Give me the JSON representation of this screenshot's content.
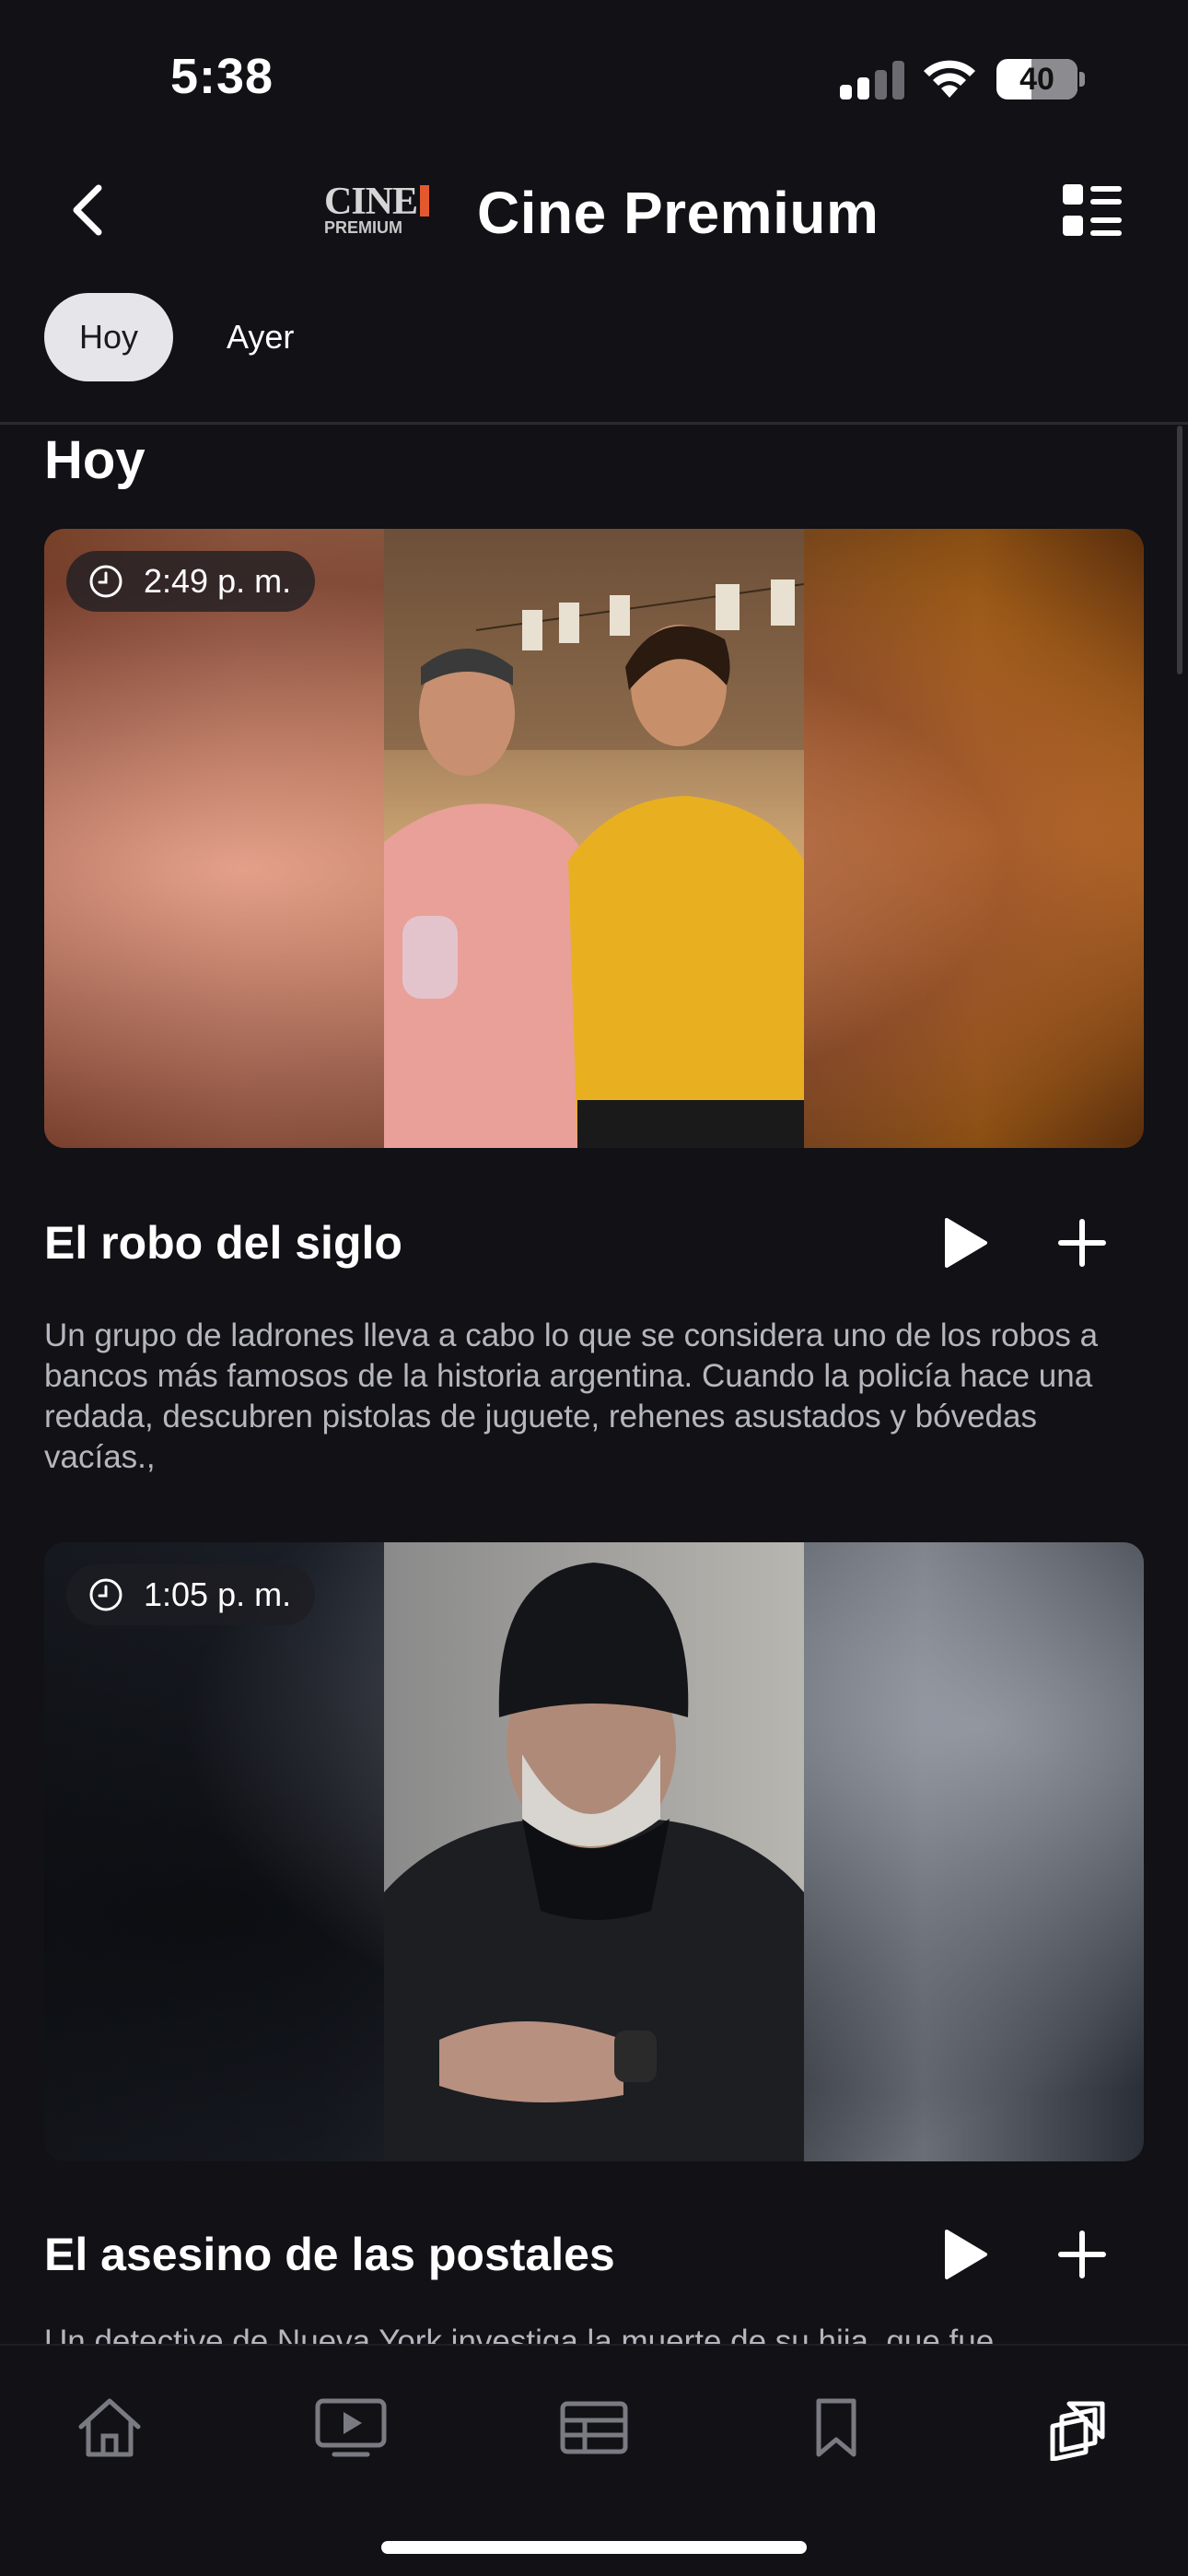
{
  "status_bar": {
    "time": "5:38",
    "battery": "40"
  },
  "header": {
    "logo_top": "CINE",
    "logo_bottom": "PREMIUM",
    "title": "Cine Premium"
  },
  "tabs": [
    {
      "label": "Hoy",
      "active": true
    },
    {
      "label": "Ayer",
      "active": false
    }
  ],
  "section_title": "Hoy",
  "movies": [
    {
      "time": "2:49 p. m.",
      "title": "El robo del siglo",
      "description": "Un grupo de ladrones lleva a cabo lo que se considera uno de los robos a bancos más famosos de la historia argentina. Cuando la policía hace una redada, descubren pistolas de juguete, rehenes asustados y bóvedas vacías.,"
    },
    {
      "time": "1:05 p. m.",
      "title": "El asesino de las postales",
      "description": "Un detective de Nueva York investiga la muerte de su hija, que fue"
    }
  ],
  "colors": {
    "background": "#111116",
    "accent": "#e4582e",
    "tab_active": "#e6e6ea"
  },
  "bottom_nav": [
    {
      "icon": "home-icon"
    },
    {
      "icon": "tv-play-icon"
    },
    {
      "icon": "guide-grid-icon"
    },
    {
      "icon": "bookmark-icon"
    },
    {
      "icon": "collection-icon"
    }
  ]
}
